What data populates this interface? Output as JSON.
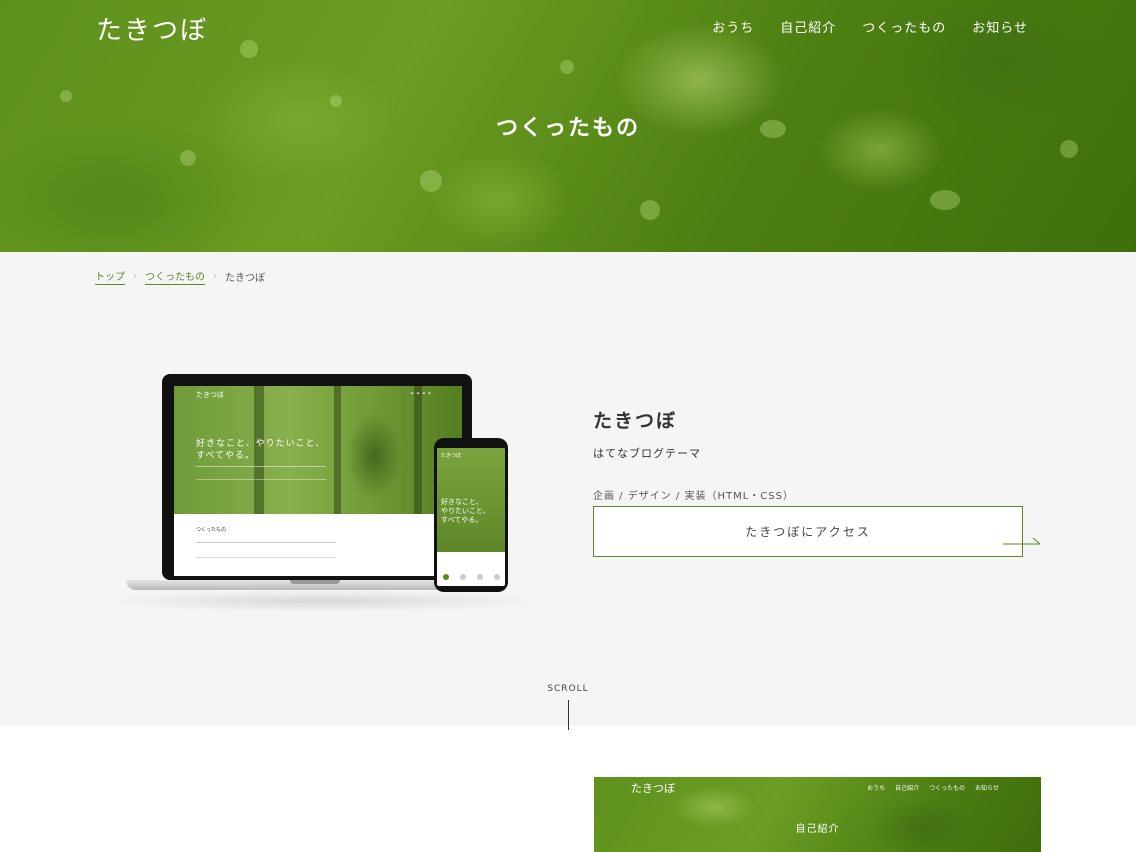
{
  "site": {
    "logo": "たきつぼ"
  },
  "nav": [
    "おうち",
    "自己紹介",
    "つくったもの",
    "お知らせ"
  ],
  "hero": {
    "title": "つくったもの"
  },
  "breadcrumb": {
    "home": "トップ",
    "parent": "つくったもの",
    "current": "たきつぼ"
  },
  "work": {
    "title": "たきつぼ",
    "subtitle": "はてなブログテーマ",
    "tags": "企画 / デザイン / 実装（HTML・CSS）",
    "access_label": "たきつぼにアクセス"
  },
  "mockup": {
    "logo": "たきつぼ",
    "headline_line1": "好きなこと、やりたいこと、",
    "headline_line2": "すべてやる。",
    "section_title": "つくったもの",
    "phone_line1": "好きなこと、",
    "phone_line2": "やりたいこと、",
    "phone_line3": "すべてやる。"
  },
  "scroll": {
    "label": "SCROLL"
  },
  "preview": {
    "logo": "たきつぼ",
    "nav": [
      "おうち",
      "自己紹介",
      "つくったもの",
      "お知らせ"
    ],
    "title": "自己紹介"
  },
  "colors": {
    "accent": "#5a8a20",
    "hero_green": "#5d8f1c",
    "section_bg": "#f5f5f5"
  }
}
